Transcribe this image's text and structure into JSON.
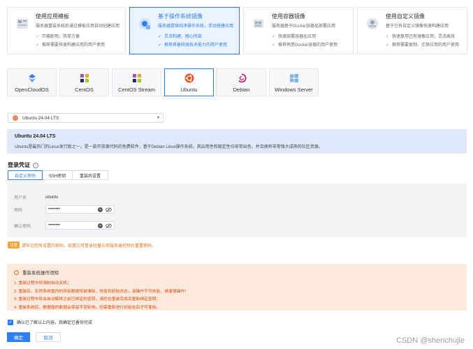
{
  "image_type_cards": [
    {
      "title": "使用应用模板",
      "desc": "服务器重装系统后通过模板应用自动创建应用",
      "features": [
        "开箱即用，简单方便",
        "推荐需要快速构建应用的用户使用"
      ],
      "icon": "template-icon",
      "active": false
    },
    {
      "title": "基于操作系统镜像",
      "desc": "服务器提供纯净操作系统，手动搭建应用",
      "features": [
        "灵活构建，随心所欲",
        "推荐具备较强技术能力的用户使用"
      ],
      "icon": "os-image-icon",
      "active": true
    },
    {
      "title": "使用容器镜像",
      "desc": "服务器基于Docker容器化部署应用",
      "features": [
        "快速部署容器化应用",
        "推荐熟悉Docker容器的用户使用"
      ],
      "icon": "container-icon",
      "active": false
    },
    {
      "title": "使用自定义镜像",
      "desc": "基于已有自定义镜像快速构建应用",
      "features": [
        "快速复用已有镜像应用，灵活高效",
        "推荐需要复制、迁移应用的用户使用"
      ],
      "icon": "custom-image-icon",
      "active": false
    }
  ],
  "os_options": [
    {
      "label": "OpenCloudOS",
      "icon": "opencloudos-icon"
    },
    {
      "label": "CentOS",
      "icon": "centos-icon"
    },
    {
      "label": "CentOS Stream",
      "icon": "centos-stream-icon"
    },
    {
      "label": "Ubuntu",
      "icon": "ubuntu-icon"
    },
    {
      "label": "Debian",
      "icon": "debian-icon"
    },
    {
      "label": "Windows Server",
      "icon": "windows-icon"
    }
  ],
  "selected_os_index": 3,
  "version_select": {
    "value": "Ubuntu 24.04 LTS"
  },
  "os_info": {
    "title": "Ubuntu 24.04 LTS",
    "desc": "Ubuntu是最热门的Linux发行版之一，是一款开放源代码的免费软件，基于Debian Linux操作系统，其启用性和稳定性均非常出色，并且拥有非常强大成熟的社区资源。"
  },
  "credentials": {
    "title": "登录凭证",
    "tabs": [
      "自定义密码",
      "SSH密钥",
      "重装后设置"
    ],
    "active_tab": 0,
    "username_label": "用户名",
    "username_value": "ubuntu",
    "password_label": "密码",
    "password_value": "••••••••",
    "confirm_label": "确认密码",
    "confirm_value": "••••••••"
  },
  "note": {
    "tag": "注意",
    "text": "请牢记您所设置的密码，如遗忘可登录轻量应用服务器控制台重置密码。"
  },
  "warning": {
    "title": "重装系统操作须知",
    "items": [
      "1. 重装过程中将强制自动关机；",
      "2. 重装后，实例系统盘内的所有数据将被清除，恢复到初始状态，该操作不可恢复，请谨慎操作！",
      "3. 重装过程中将会自动解绑之前已绑定的密钥，请您在重装完成后重新绑定密钥；",
      "4. 重装系统后，数据盘的数据会保留不受影响，但需重新进行初始化后才可使用。"
    ]
  },
  "agree_text": "确认已了解以上内容，我确定已备份完成",
  "buttons": {
    "confirm": "确定",
    "cancel": "取消"
  },
  "watermark": "CSDN @shenchujie",
  "colors": {
    "accent": "#2e7ff7",
    "warning": "#e37318",
    "info_bg": "#dfe9fb",
    "warn_bg": "#fdeadc"
  }
}
